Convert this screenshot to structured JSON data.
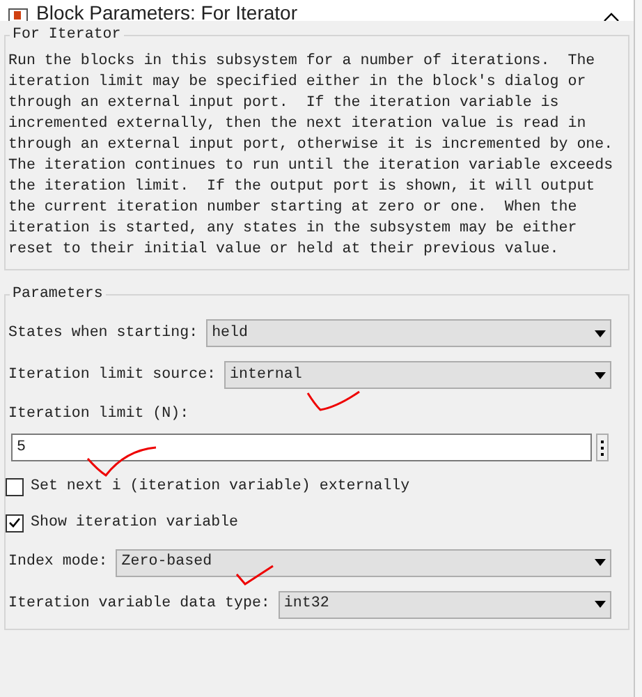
{
  "window": {
    "title": "Block Parameters: For Iterator"
  },
  "description": {
    "title": "For Iterator",
    "text": "Run the blocks in this subsystem for a number of iterations.  The\niteration limit may be specified either in the block's dialog or\nthrough an external input port.  If the iteration variable is\nincremented externally, then the next iteration value is read in\nthrough an external input port, otherwise it is incremented by one.\nThe iteration continues to run until the iteration variable exceeds\nthe iteration limit.  If the output port is shown, it will output\nthe current iteration number starting at zero or one.  When the\niteration is started, any states in the subsystem may be either\nreset to their initial value or held at their previous value."
  },
  "parameters": {
    "title": "Parameters",
    "fields": [
      {
        "kind": "dropdown",
        "label": "States when starting:",
        "value": "held"
      },
      {
        "kind": "dropdown",
        "label": "Iteration limit source:",
        "value": "internal"
      },
      {
        "kind": "text",
        "label": "Iteration limit (N):",
        "value": "5"
      },
      {
        "kind": "checkbox",
        "label": "Set next i (iteration variable) externally",
        "checked": false
      },
      {
        "kind": "checkbox",
        "label": "Show iteration variable",
        "checked": true
      },
      {
        "kind": "dropdown",
        "label": "Index mode:",
        "value": "Zero-based"
      },
      {
        "kind": "dropdown",
        "label": "Iteration variable data type:",
        "value": "int32"
      }
    ]
  }
}
